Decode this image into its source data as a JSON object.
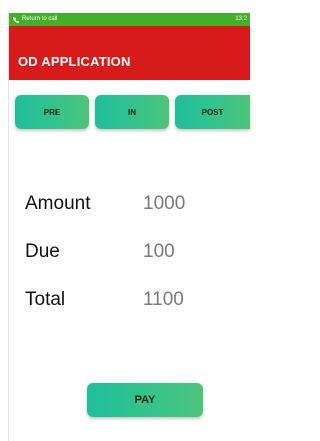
{
  "status_bar": {
    "call_text": "Return to call",
    "time": "13:2",
    "color": "#43b02a"
  },
  "app_bar": {
    "title": "OD APPLICATION",
    "color": "#d71a1a"
  },
  "tabs": [
    {
      "label": "PRE"
    },
    {
      "label": "IN"
    },
    {
      "label": "POST"
    }
  ],
  "summary": {
    "amount": {
      "label": "Amount",
      "value": "1000"
    },
    "due": {
      "label": "Due",
      "value": "100"
    },
    "total": {
      "label": "Total",
      "value": "1100"
    }
  },
  "pay_button": {
    "label": "PAY"
  },
  "accent_color": "#2fc290",
  "icons": {
    "status_call": "phone-icon"
  }
}
